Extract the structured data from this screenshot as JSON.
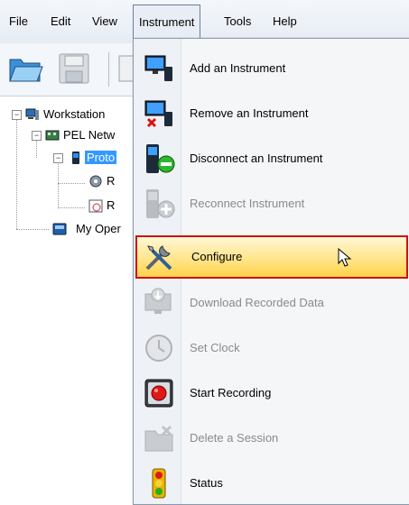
{
  "menubar": {
    "items": [
      {
        "label": "File"
      },
      {
        "label": "Edit"
      },
      {
        "label": "View"
      },
      {
        "label": "Instrument"
      },
      {
        "label": "Tools"
      },
      {
        "label": "Help"
      }
    ]
  },
  "tree": {
    "workstation": "Workstation",
    "pel_network": "PEL Netw",
    "protocol": "Proto",
    "child1": "R",
    "child2": "R",
    "my_open": "My Oper"
  },
  "instrument_menu": {
    "items": [
      {
        "label": "Add an Instrument",
        "icon": "add-instrument-icon",
        "enabled": true
      },
      {
        "label": "Remove an Instrument",
        "icon": "remove-instrument-icon",
        "enabled": true
      },
      {
        "label": "Disconnect an Instrument",
        "icon": "disconnect-instrument-icon",
        "enabled": true
      },
      {
        "label": "Reconnect Instrument",
        "icon": "reconnect-instrument-icon",
        "enabled": false
      },
      {
        "label": "Configure",
        "icon": "configure-tools-icon",
        "enabled": true,
        "highlighted": true
      },
      {
        "label": "Download Recorded Data",
        "icon": "download-data-icon",
        "enabled": false
      },
      {
        "label": "Set Clock",
        "icon": "clock-icon",
        "enabled": false
      },
      {
        "label": "Start Recording",
        "icon": "record-button-icon",
        "enabled": true
      },
      {
        "label": "Delete a Session",
        "icon": "delete-folder-icon",
        "enabled": false
      },
      {
        "label": "Status",
        "icon": "traffic-light-icon",
        "enabled": true
      }
    ]
  },
  "colors": {
    "highlight_border": "#cc1111",
    "selection": "#3399ff",
    "disabled_text": "#8a8a8a"
  }
}
